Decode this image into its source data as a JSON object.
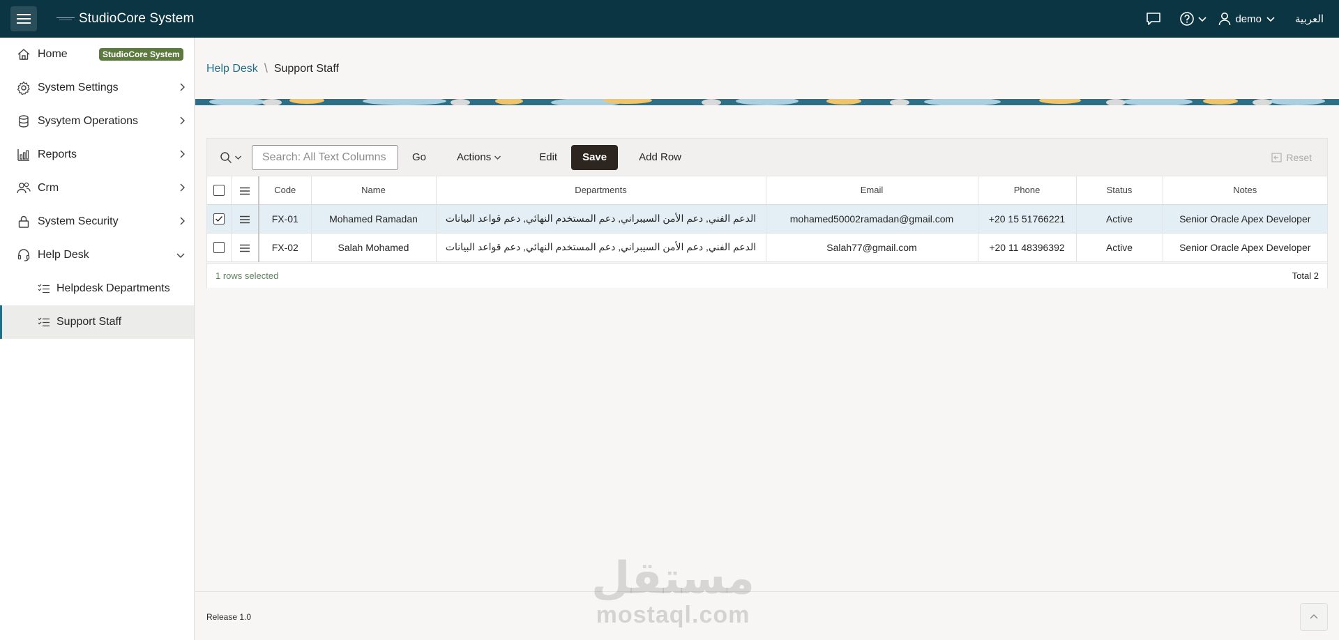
{
  "header": {
    "app_title": "StudioCore System",
    "user_name": "demo",
    "language_link": "العربية",
    "colors": {
      "header_bg": "#0c3543",
      "accent": "#1f6f8b",
      "badge": "#5c7a3e"
    }
  },
  "sidebar": {
    "items": [
      {
        "label": "Home",
        "icon": "home-icon",
        "badge": "StudioCore System"
      },
      {
        "label": "System Settings",
        "icon": "gear-icon"
      },
      {
        "label": "Sysytem Operations",
        "icon": "database-icon"
      },
      {
        "label": "Reports",
        "icon": "bar-chart-icon"
      },
      {
        "label": "Crm",
        "icon": "users-icon"
      },
      {
        "label": "System Security",
        "icon": "lock-icon"
      },
      {
        "label": "Help Desk",
        "icon": "headset-icon",
        "expanded": true
      }
    ],
    "sub_items": [
      {
        "label": "Helpdesk Departments",
        "icon": "checklist-icon"
      },
      {
        "label": "Support Staff",
        "icon": "checklist-icon",
        "active": true
      }
    ]
  },
  "breadcrumb": {
    "parent": "Help Desk",
    "current": "Support Staff"
  },
  "toolbar": {
    "search_placeholder": "Search: All Text Columns",
    "go_label": "Go",
    "actions_label": "Actions",
    "edit_label": "Edit",
    "save_label": "Save",
    "add_row_label": "Add Row",
    "reset_label": "Reset"
  },
  "grid": {
    "columns": [
      "Code",
      "Name",
      "Departments",
      "Email",
      "Phone",
      "Status",
      "Notes"
    ],
    "rows": [
      {
        "selected": true,
        "code": "FX-01",
        "name": "Mohamed Ramadan",
        "departments": "الدعم الفني, دعم الأمن السيبراني, دعم المستخدم النهائي, دعم قواعد البيانات",
        "email": "mohamed50002ramadan@gmail.com",
        "phone": "+20 15 51766221",
        "status": "Active",
        "notes": "Senior Oracle Apex Developer"
      },
      {
        "selected": false,
        "code": "FX-02",
        "name": "Salah Mohamed",
        "departments": "الدعم الفني, دعم الأمن السيبراني, دعم المستخدم النهائي, دعم قواعد البيانات",
        "email": "Salah77@gmail.com",
        "phone": "+20 11 48396392",
        "status": "Active",
        "notes": "Senior Oracle Apex Developer"
      }
    ],
    "selection_text": "1 rows selected",
    "total_text": "Total 2"
  },
  "footer": {
    "release": "Release 1.0"
  },
  "watermark": {
    "arabic": "مستقل",
    "latin": "mostaql.com"
  }
}
